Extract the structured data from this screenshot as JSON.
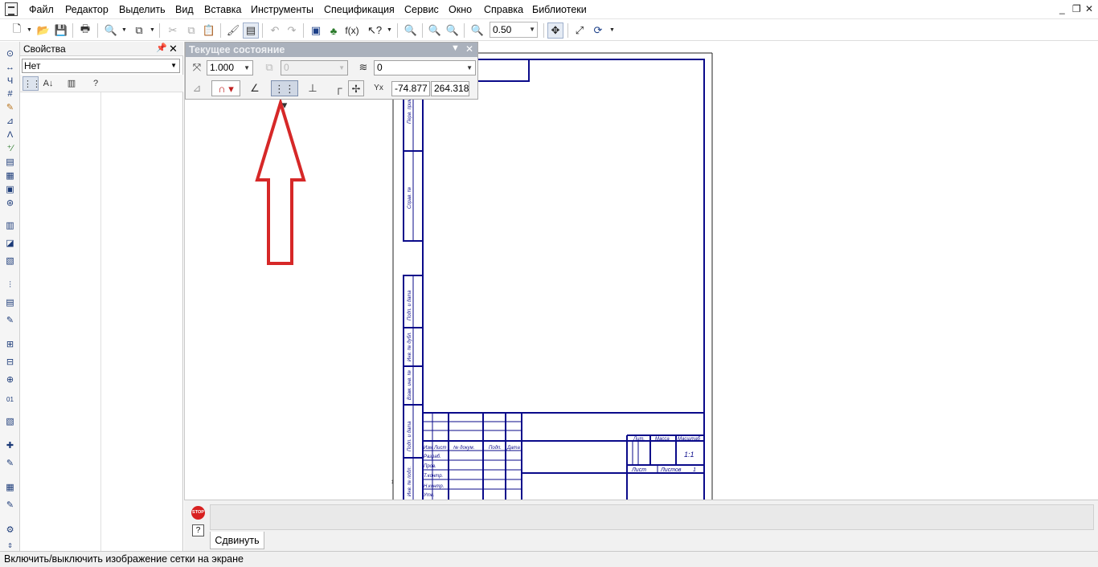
{
  "menu": {
    "items": [
      "Файл",
      "Редактор",
      "Выделить",
      "Вид",
      "Вставка",
      "Инструменты",
      "Спецификация",
      "Сервис",
      "Окно",
      "Справка",
      "Библиотеки"
    ]
  },
  "toolbar": {
    "zoom_value": "0.50"
  },
  "properties_panel": {
    "title": "Свойства",
    "pin_icon": "pin-icon",
    "close_icon": "close-icon",
    "combo_value": "Нет"
  },
  "current_state_panel": {
    "title": "Текущее состояние",
    "step": "1.000",
    "disabled_value": "0",
    "layer": "0",
    "x_coord": "-74.877",
    "y_coord": "264.318"
  },
  "drawing": {
    "title_block": {
      "headers": [
        "Изм",
        "Лист",
        "№ докум.",
        "Подп.",
        "Дата"
      ],
      "rows": [
        "Разраб.",
        "Пров.",
        "Т.контр.",
        "Н.контр.",
        "Утв."
      ],
      "right_headers": [
        "Лит.",
        "Масса",
        "Масштаб"
      ],
      "scale": "1:1",
      "sheet_label": "Лист",
      "sheets_label": "Листов",
      "sheets_count": "1"
    },
    "side_stamps": [
      "Перв. примен.",
      "Справ. №",
      "Подп. и дата",
      "Инв. № дубл.",
      "Взам. инв. №",
      "Подп. и дата",
      "Инв. № подл."
    ],
    "arrow_color": "#d62828",
    "frame_color": "#0a0a8a"
  },
  "command_area": {
    "stop_label": "STOP",
    "help_label": "?",
    "tab_label": "Сдвинуть"
  },
  "statusbar": {
    "text": "Включить/выключить изображение сетки на экране"
  }
}
